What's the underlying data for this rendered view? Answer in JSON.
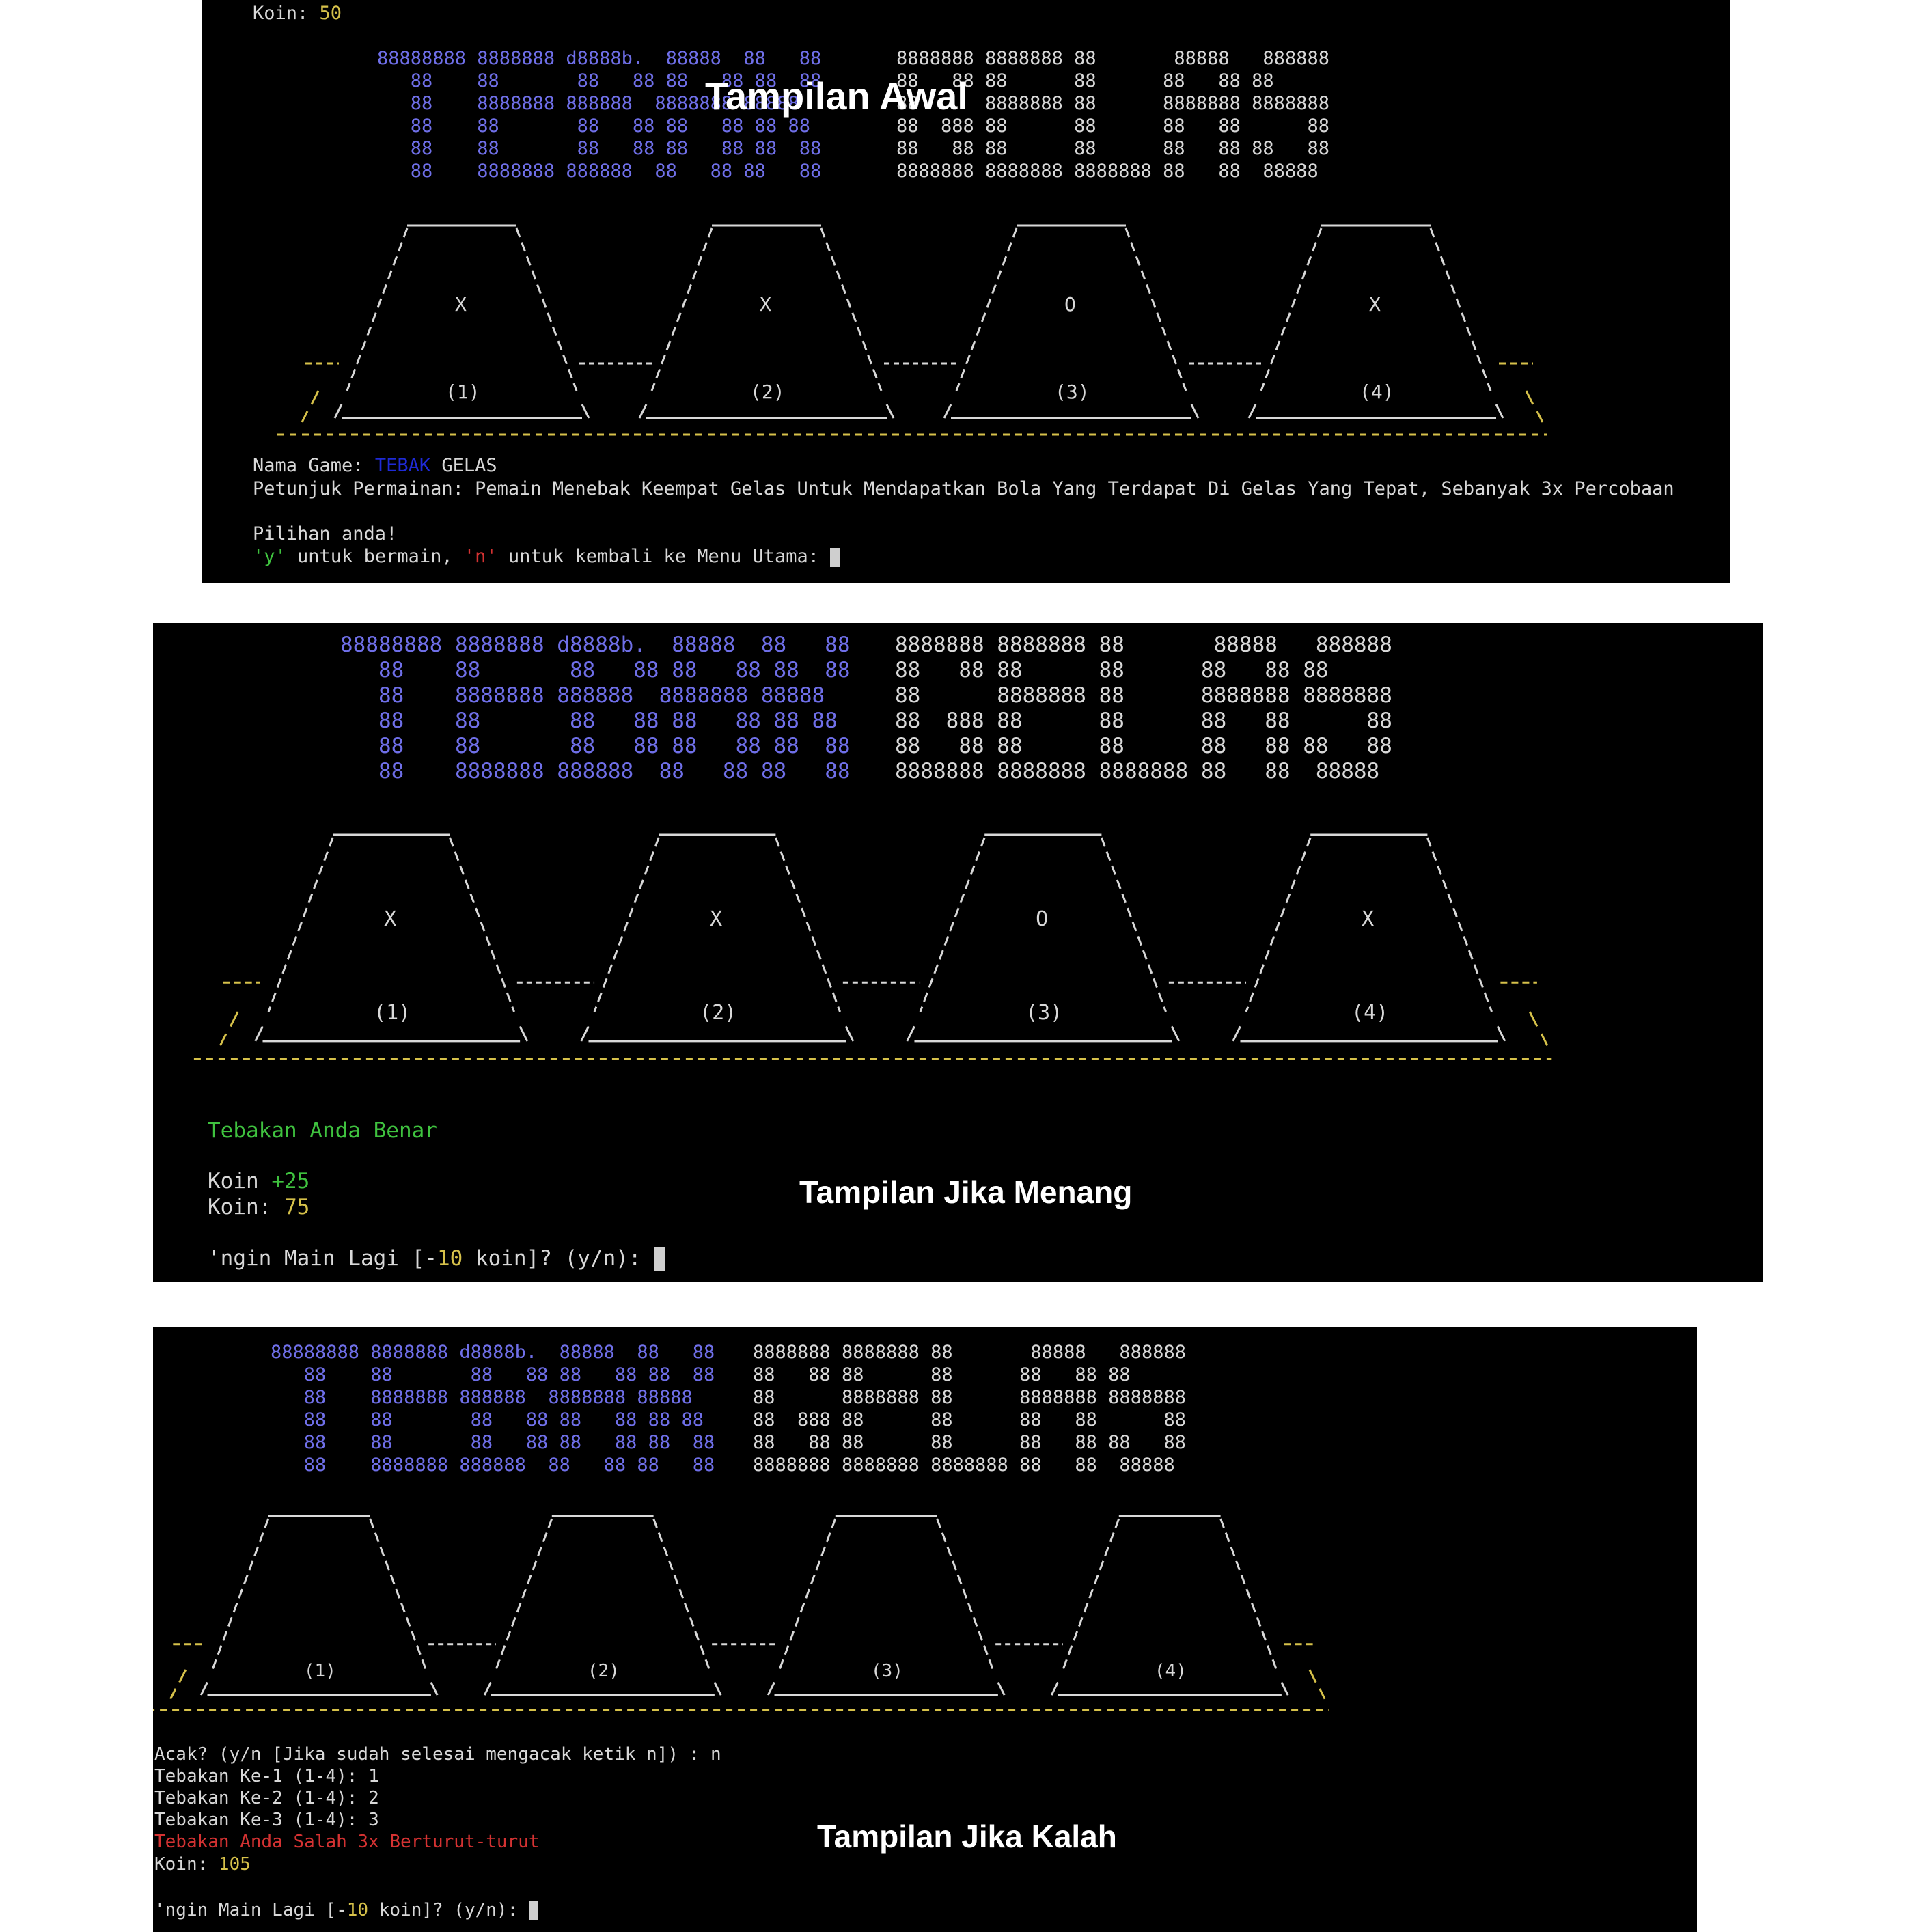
{
  "banner": {
    "tebak": [
      "88888888 8888888 d8888b.  88888  88   88",
      "   88    88       88   88 88   88 88  88",
      "   88    8888888 888888  8888888 88888",
      "   88    88       88   88 88   88 88 88",
      "   88    88       88   88 88   88 88  88",
      "   88    8888888 888888  88   88 88   88"
    ],
    "gelas": [
      "8888888 8888888 88       88888   888888",
      "88   88 88      88      88   88 88",
      "88      8888888 88      8888888 8888888",
      "88  888 88      88      88   88      88",
      "88   88 88      88      88   88 88   88",
      "8888888 8888888 8888888 88   88  88888"
    ]
  },
  "cups": {
    "labels": [
      "(1)",
      "(2)",
      "(3)",
      "(4)"
    ],
    "marks_revealed": [
      "X",
      "X",
      "O",
      "X"
    ],
    "marks_hidden": [
      "",
      "",
      "",
      ""
    ]
  },
  "screen1": {
    "caption": "Tampilan Awal",
    "coin_label": "Koin: ",
    "coin_value": "50",
    "game_name_label": "Nama Game: ",
    "game_name_tebak": "TEBAK",
    "game_name_gelas": " GELAS",
    "instructions": "Petunjuk Permainan: Pemain Menebak Keempat Gelas Untuk Mendapatkan Bola Yang Terdapat Di Gelas Yang Tepat, Sebanyak 3x Percobaan",
    "choice_prompt": "Pilihan anda!",
    "y_key": "'y'",
    "y_text": " untuk bermain, ",
    "n_key": "'n'",
    "n_text": " untuk kembali ke Menu Utama: "
  },
  "screen2": {
    "caption": "Tampilan Jika Menang",
    "result": "Tebakan Anda Benar",
    "bonus_label": "Koin ",
    "bonus_value": "+25",
    "coin_label": "Koin: ",
    "coin_value": "75",
    "again_a": "'ngin Main Lagi [-",
    "again_cost": "10",
    "again_b": " koin]? (y/n): "
  },
  "screen3": {
    "caption": "Tampilan Jika Kalah",
    "shuffle_prompt": "Acak? (y/n [Jika sudah selesai mengacak ketik n]) : n",
    "guesses": [
      "Tebakan Ke-1 (1-4): 1",
      "Tebakan Ke-2 (1-4): 2",
      "Tebakan Ke-3 (1-4): 3"
    ],
    "result": "Tebakan Anda Salah 3x Berturut-turut",
    "coin_label": "Koin: ",
    "coin_value": "105",
    "again_a": "'ngin Main Lagi [-",
    "again_cost": "10",
    "again_b": " koin]? (y/n): "
  },
  "colors": {
    "terminal_bg": "#000000",
    "banner_tebak": "#6f6fe8",
    "banner_gelas": "#d8d8d8",
    "coin_value": "#d6c14a",
    "success": "#3fc23f",
    "failure": "#d43232"
  }
}
